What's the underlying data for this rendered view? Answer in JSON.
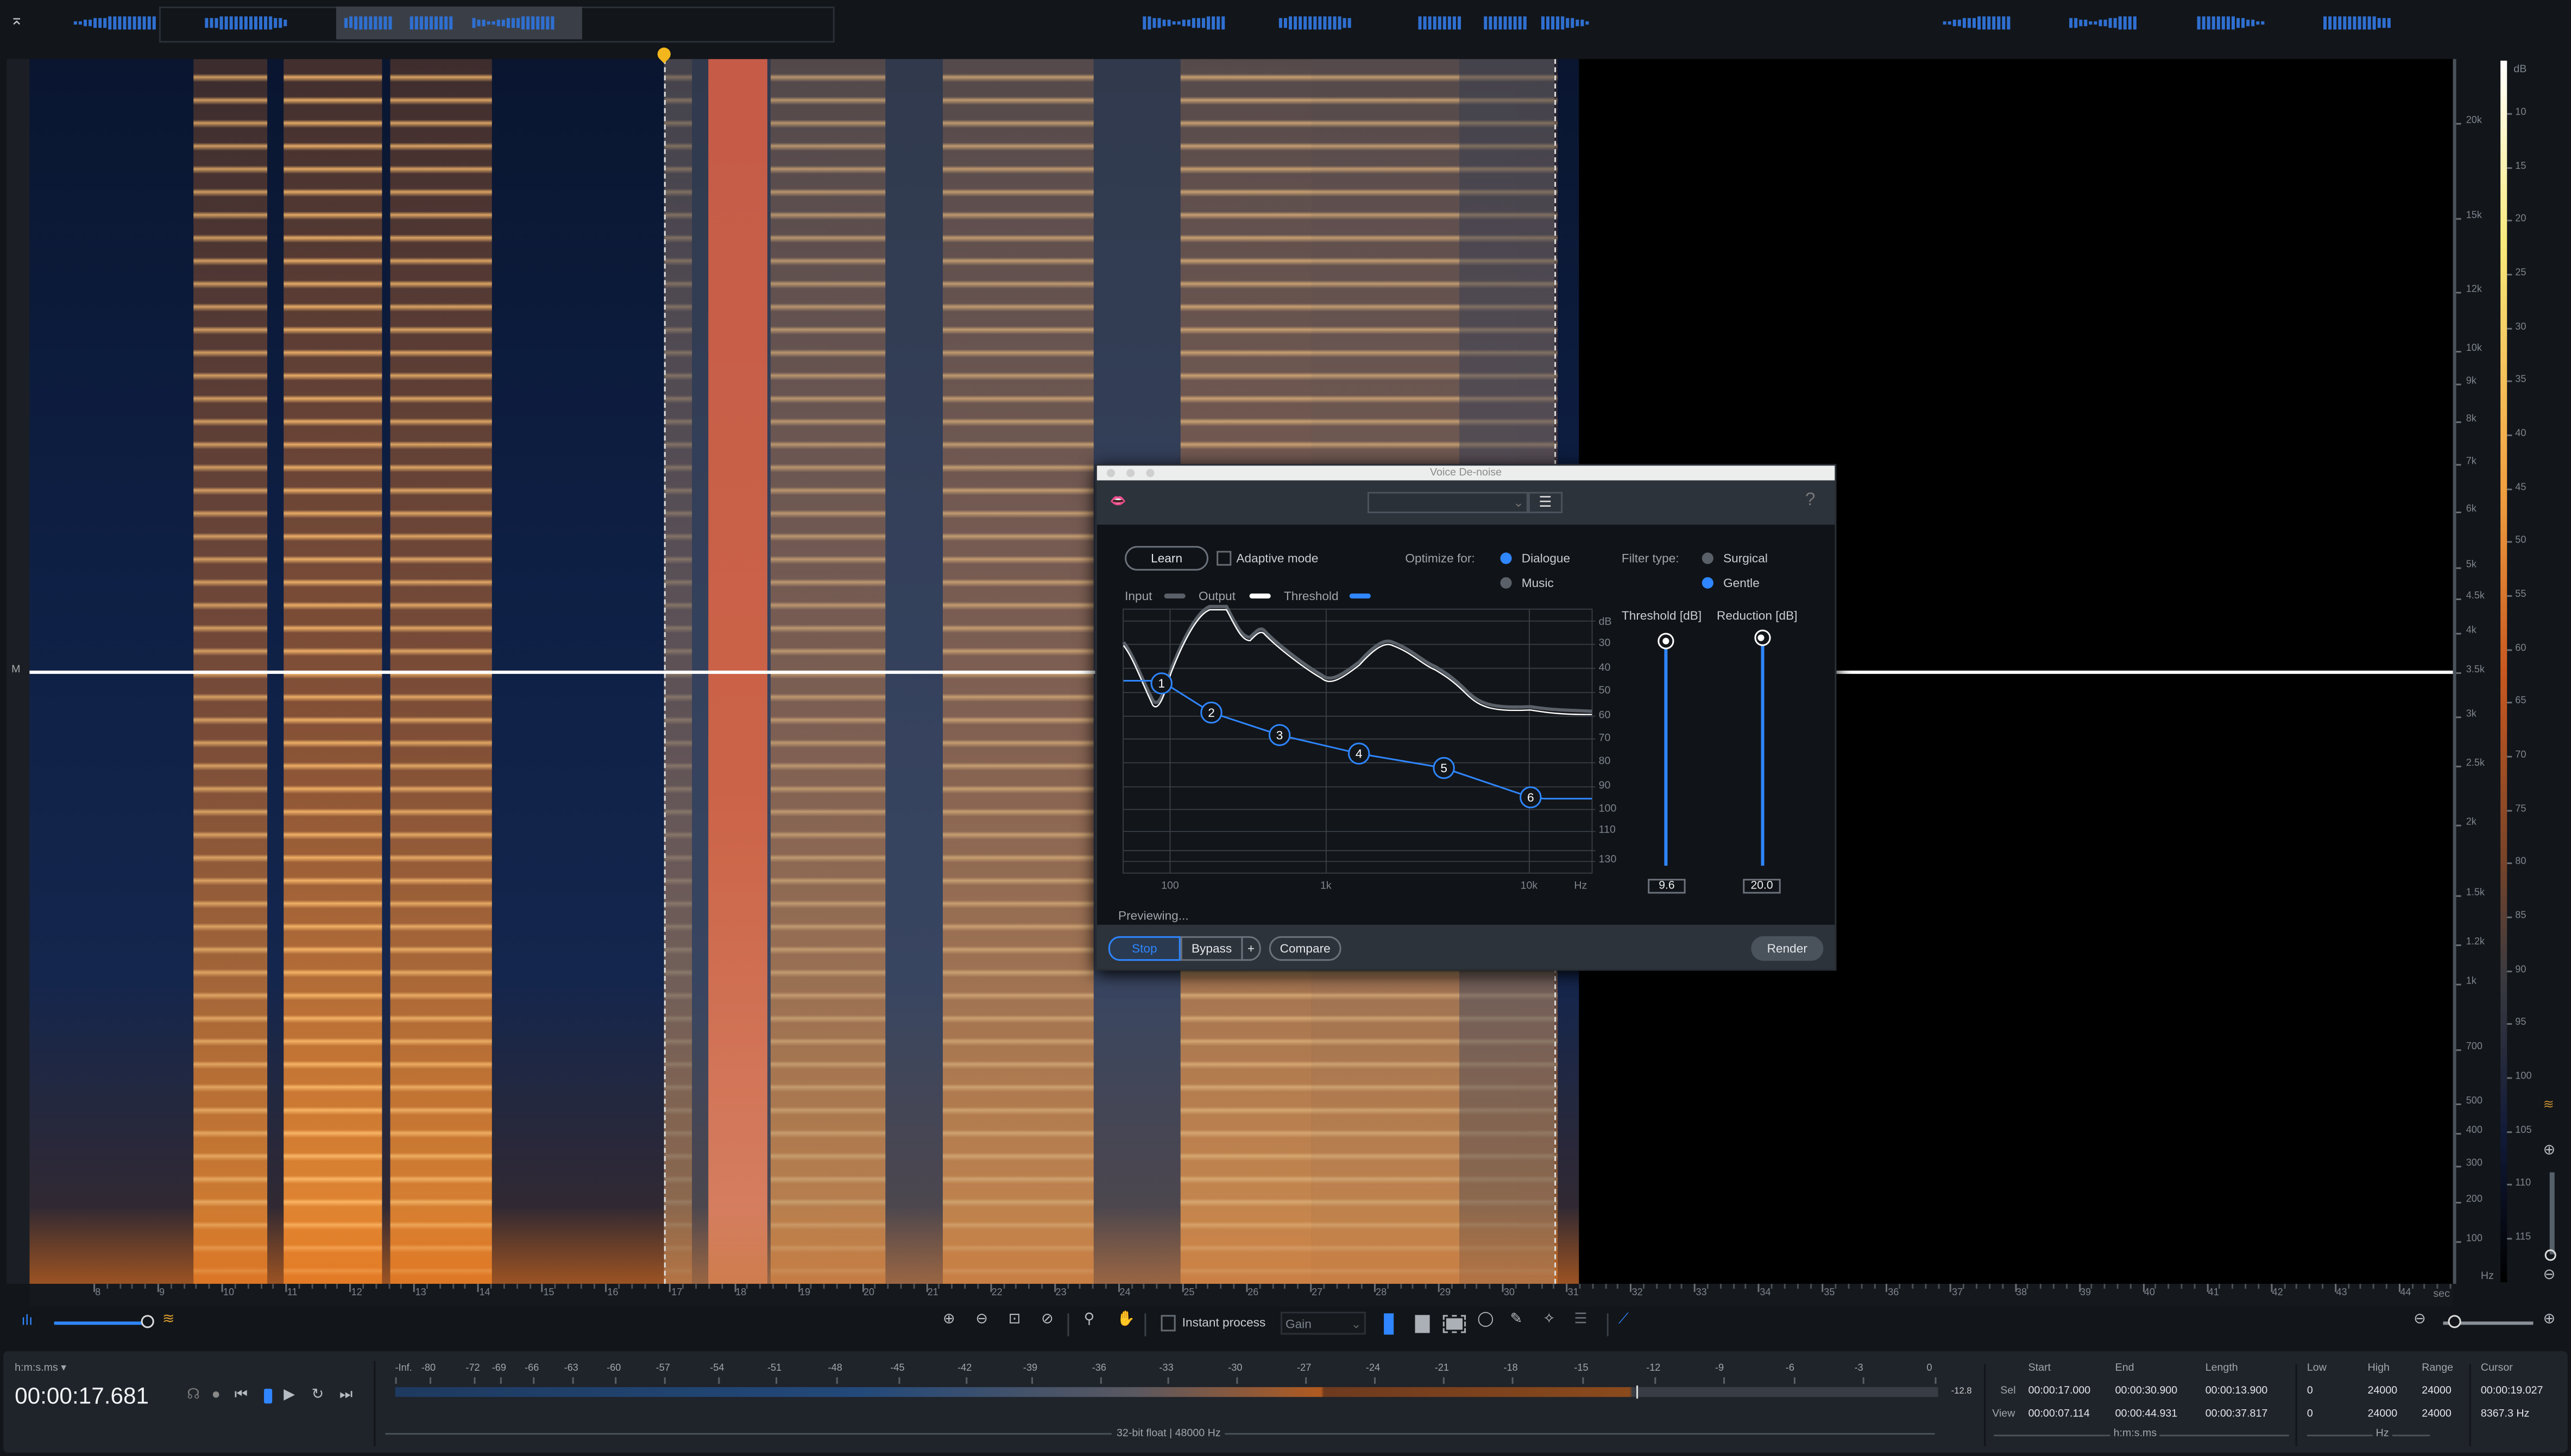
{
  "overview": {
    "icon": "collapse-icon"
  },
  "spectrogram": {
    "marker_label": "M",
    "time_unit": "sec",
    "time_ticks": [
      "8",
      "9",
      "10",
      "11",
      "12",
      "13",
      "14",
      "15",
      "16",
      "17",
      "18",
      "19",
      "20",
      "21",
      "22",
      "23",
      "24",
      "25",
      "26",
      "27",
      "28",
      "29",
      "30",
      "31",
      "32",
      "33",
      "34",
      "35",
      "36",
      "37",
      "38",
      "39",
      "40",
      "41",
      "42",
      "43",
      "44"
    ],
    "freq_ticks": [
      "20k",
      "15k",
      "12k",
      "10k",
      "9k",
      "8k",
      "7k",
      "6k",
      "5k",
      "4.5k",
      "4k",
      "3.5k",
      "3k",
      "2.5k",
      "2k",
      "1.5k",
      "1.2k",
      "1k",
      "700",
      "500",
      "400",
      "300",
      "200",
      "100"
    ],
    "freq_unit": "Hz",
    "db_unit": "dB",
    "db_ticks": [
      "10",
      "15",
      "20",
      "25",
      "30",
      "35",
      "40",
      "45",
      "50",
      "55",
      "60",
      "65",
      "70",
      "75",
      "80",
      "85",
      "90",
      "95",
      "100",
      "105",
      "110",
      "115"
    ]
  },
  "dialog": {
    "title": "Voice De-noise",
    "preset_value": "",
    "help": "?",
    "learn": "Learn",
    "adaptive_mode": "Adaptive mode",
    "adaptive_checked": false,
    "optimize_label": "Optimize for:",
    "optimize_options": [
      "Dialogue",
      "Music"
    ],
    "optimize_selected": "Dialogue",
    "filter_label": "Filter type:",
    "filter_options": [
      "Surgical",
      "Gentle"
    ],
    "filter_selected": "Gentle",
    "legend": [
      "Input",
      "Output",
      "Threshold"
    ],
    "graph": {
      "db_unit": "dB",
      "db_ticks": [
        "30",
        "40",
        "50",
        "60",
        "70",
        "80",
        "90",
        "100",
        "110",
        "130"
      ],
      "freq_ticks": [
        "100",
        "1k",
        "10k"
      ],
      "freq_unit": "Hz",
      "nodes": [
        "1",
        "2",
        "3",
        "4",
        "5",
        "6"
      ]
    },
    "threshold_label": "Threshold [dB]",
    "threshold_value": "9.6",
    "reduction_label": "Reduction [dB]",
    "reduction_value": "20.0",
    "status": "Previewing...",
    "stop": "Stop",
    "bypass": "Bypass",
    "plus": "+",
    "compare": "Compare",
    "render": "Render",
    "colors": {
      "accent": "#2f86ff",
      "input": "#5a6068",
      "output": "#ffffff"
    }
  },
  "toolbar": {
    "instant_process": "Instant process",
    "instant_checked": false,
    "mode_value": "Gain"
  },
  "transport": {
    "format_label": "h:m:s.ms",
    "time": "00:00:17.681"
  },
  "meter": {
    "labels": [
      "-Inf.",
      "-80",
      "-72",
      "-69",
      "-66",
      "-63",
      "-60",
      "-57",
      "-54",
      "-51",
      "-48",
      "-45",
      "-42",
      "-39",
      "-36",
      "-33",
      "-30",
      "-27",
      "-24",
      "-21",
      "-18",
      "-15",
      "-12",
      "-9",
      "-6",
      "-3",
      "0"
    ],
    "peak": "-12.8",
    "format": "32-bit float | 48000 Hz"
  },
  "info": {
    "headers": [
      "Start",
      "End",
      "Length",
      "Low",
      "High",
      "Range",
      "Cursor"
    ],
    "sel": {
      "label": "Sel",
      "start": "00:00:17.000",
      "end": "00:00:30.900",
      "length": "00:00:13.900",
      "low": "0",
      "high": "24000",
      "range": "24000",
      "cursor": "00:00:19.027"
    },
    "view": {
      "label": "View",
      "start": "00:00:07.114",
      "end": "00:00:44.931",
      "length": "00:00:37.817",
      "low": "0",
      "high": "24000",
      "range": "24000",
      "cursor": "8367.3 Hz"
    },
    "time_unit": "h:m:s.ms",
    "freq_unit": "Hz"
  }
}
